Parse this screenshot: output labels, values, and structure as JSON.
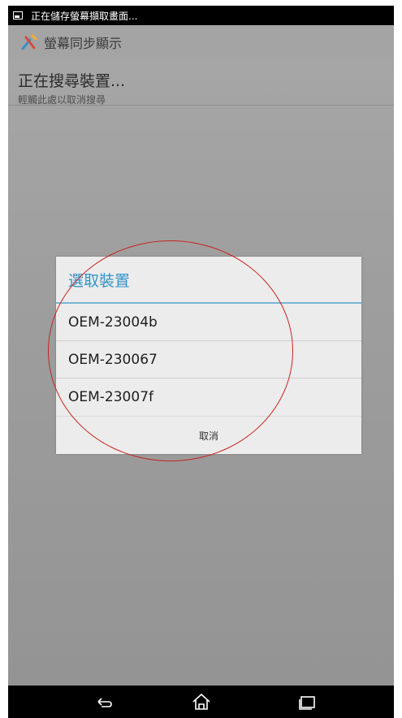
{
  "status_bar": {
    "notification_text": "正在儲存螢幕擷取畫面..."
  },
  "action_bar": {
    "title": "螢幕同步顯示"
  },
  "searching": {
    "title": "正在搜尋裝置...",
    "subtitle": "輕觸此處以取消搜尋"
  },
  "dialog": {
    "title": "選取裝置",
    "devices": [
      "OEM-23004b",
      "OEM-230067",
      "OEM-23007f"
    ],
    "cancel_label": "取消"
  },
  "colors": {
    "dialog_title": "#3394c8",
    "annotation": "#c8231f"
  },
  "icons": {
    "back": "back-icon",
    "home": "home-icon",
    "recents": "recents-icon"
  }
}
